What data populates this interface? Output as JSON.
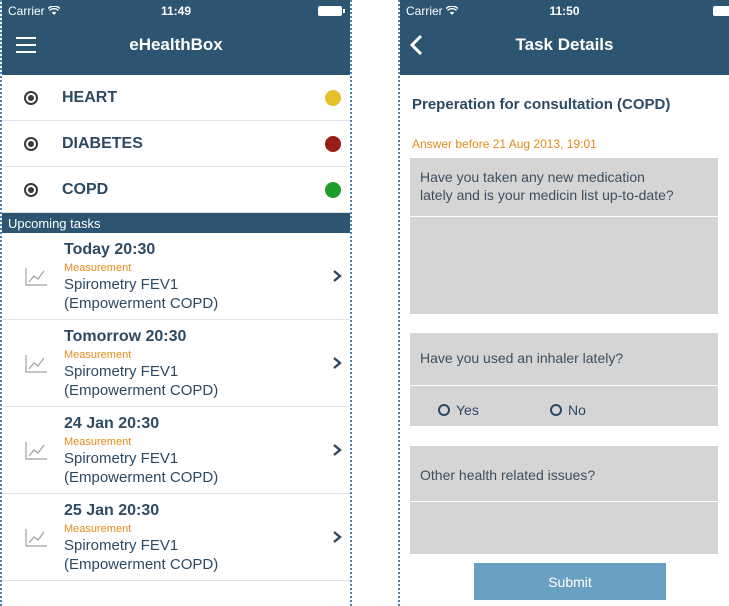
{
  "left": {
    "status": {
      "carrier": "Carrier",
      "time": "11:49"
    },
    "nav": {
      "title": "eHealthBox"
    },
    "conditions": [
      {
        "label": "HEART",
        "status_color": "#e6c02a"
      },
      {
        "label": "DIABETES",
        "status_color": "#9b1c14"
      },
      {
        "label": "COPD",
        "status_color": "#1f9e2b"
      }
    ],
    "section_header": "Upcoming tasks",
    "tasks": [
      {
        "date": "Today 20:30",
        "type": "Measurement",
        "name1": "Spirometry FEV1",
        "name2": "(Empowerment COPD)",
        "icon": "chart-line-icon"
      },
      {
        "date": "Tomorrow 20:30",
        "type": "Measurement",
        "name1": "Spirometry FEV1",
        "name2": "(Empowerment COPD)",
        "icon": "chart-line-icon"
      },
      {
        "date": "24 Jan 20:30",
        "type": "Measurement",
        "name1": "Spirometry FEV1",
        "name2": "(Empowerment COPD)",
        "icon": "chart-line-icon"
      },
      {
        "date": "25 Jan 20:30",
        "type": "Measurement",
        "name1": "Spirometry FEV1",
        "name2": "(Empowerment COPD)",
        "icon": "chart-line-icon"
      }
    ]
  },
  "right": {
    "status": {
      "carrier": "Carrier",
      "time": "11:50"
    },
    "nav": {
      "title": "Task Details",
      "back_icon": "chevron-left-icon"
    },
    "task_title": "Preperation for consultation (COPD)",
    "deadline": "Answer before 21 Aug 2013, 19:01",
    "questions": [
      {
        "line1": "Have you taken any new medication",
        "line2": "lately and is your medicin list up-to-date?"
      },
      {
        "line1": "Have you used an inhaler lately?",
        "options": [
          "Yes",
          "No"
        ]
      },
      {
        "line1": "Other health related issues?"
      }
    ],
    "submit_label": "Submit"
  },
  "colors": {
    "navbar": "#2d5470",
    "accent_orange": "#e28b1c",
    "submit": "#6aa0c1",
    "text_dark": "#2d4a63"
  }
}
